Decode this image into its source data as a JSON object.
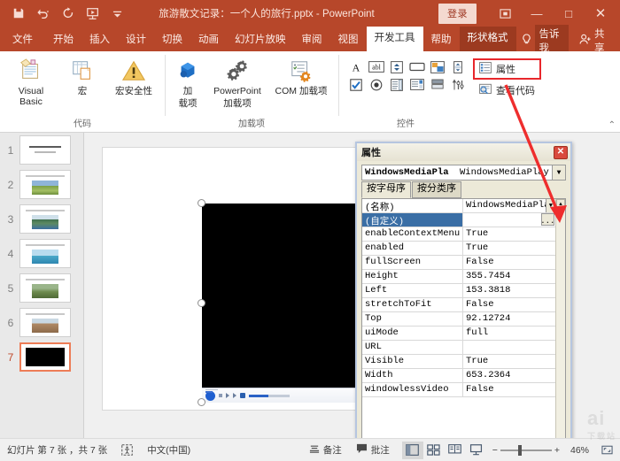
{
  "titlebar": {
    "quick_access": [
      {
        "name": "save-icon",
        "label": "保存"
      },
      {
        "name": "undo-icon",
        "label": "撤销"
      },
      {
        "name": "redo-icon",
        "label": "恢复"
      },
      {
        "name": "start-slideshow-icon",
        "label": "从头开始"
      },
      {
        "name": "customize-qat-icon",
        "label": "自定义快速访问工具栏"
      }
    ],
    "document_title": "旅游散文记录：一个人的旅行.pptx",
    "app_name": "PowerPoint",
    "title_separator": "-",
    "signin_label": "登录",
    "ribbon_display_icon": "ribbon-display-options-icon",
    "minimize_label": "—",
    "maximize_label": "□",
    "close_label": "✕"
  },
  "tabs": [
    {
      "label": "文件",
      "state": "file"
    },
    {
      "label": "开始",
      "state": "normal"
    },
    {
      "label": "插入",
      "state": "normal"
    },
    {
      "label": "设计",
      "state": "normal"
    },
    {
      "label": "切换",
      "state": "normal"
    },
    {
      "label": "动画",
      "state": "normal"
    },
    {
      "label": "幻灯片放映",
      "state": "normal"
    },
    {
      "label": "审阅",
      "state": "normal"
    },
    {
      "label": "视图",
      "state": "normal"
    },
    {
      "label": "开发工具",
      "state": "active"
    },
    {
      "label": "帮助",
      "state": "normal"
    },
    {
      "label": "形状格式",
      "state": "contextual"
    }
  ],
  "tellme": {
    "icon": "lightbulb-icon",
    "label": "告诉我"
  },
  "share": {
    "icon": "share-person-icon",
    "label": "共享"
  },
  "ribbon": {
    "groups": [
      {
        "label": "代码",
        "buttons": [
          {
            "name": "visual-basic-button",
            "label": "Visual Basic",
            "icon": "visual-basic-icon"
          },
          {
            "name": "macro-button",
            "label": "宏",
            "icon": "macro-icon"
          },
          {
            "name": "macro-security-button",
            "label": "宏安全性",
            "icon": "warning-triangle-icon"
          }
        ]
      },
      {
        "label": "加载项",
        "buttons": [
          {
            "name": "addins-button",
            "label": "加\n载项",
            "label_line1": "加",
            "label_line2": "载项",
            "icon": "addins-cube-icon"
          },
          {
            "name": "powerpoint-addins-button",
            "label_line1": "PowerPoint",
            "label_line2": "加载项",
            "icon": "gears-icon"
          },
          {
            "name": "com-addins-button",
            "label_line1": "COM 加载项",
            "label_line2": "",
            "icon": "com-addins-icon"
          }
        ]
      },
      {
        "label": "控件",
        "control_icons_row1": [
          "label-A-icon",
          "textbox-abl-icon",
          "spin-button-icon",
          "command-button-icon",
          "image-control-icon",
          "scrollbar-icon"
        ],
        "control_icons_row2": [
          "checkbox-icon",
          "option-button-icon",
          "listbox-icon",
          "combobox-icon",
          "toggle-button-icon",
          "more-controls-icon"
        ],
        "properties_button": {
          "name": "properties-button",
          "label": "属性",
          "icon": "properties-icon",
          "highlighted": true
        },
        "view_code_button": {
          "name": "view-code-button",
          "label": "查看代码",
          "icon": "view-code-icon"
        }
      }
    ],
    "collapse_ribbon_icon": "chevron-up-icon"
  },
  "thumbnails": [
    {
      "number": "1",
      "selected": false,
      "type": "title"
    },
    {
      "number": "2",
      "selected": false,
      "type": "photo"
    },
    {
      "number": "3",
      "selected": false,
      "type": "photo"
    },
    {
      "number": "4",
      "selected": false,
      "type": "photo"
    },
    {
      "number": "5",
      "selected": false,
      "type": "photo"
    },
    {
      "number": "6",
      "selected": false,
      "type": "photo"
    },
    {
      "number": "7",
      "selected": true,
      "type": "video"
    }
  ],
  "slide": {
    "media_object_name": "windows-media-player-object",
    "selection_handles": 4
  },
  "properties_window": {
    "title": "属性",
    "close_label": "✕",
    "combo_left": "WindowsMediaPla",
    "combo_right": "WindowsMediaPlay",
    "tab_alphabetic": "按字母序",
    "tab_categorized": "按分类序",
    "rows": [
      {
        "key": "(名称)",
        "value": "WindowsMediaPlay",
        "selected": false,
        "dropdown": true
      },
      {
        "key": "(自定义)",
        "value": "",
        "selected": true,
        "builder": "..."
      },
      {
        "key": "enableContextMenu",
        "value": "True",
        "selected": false
      },
      {
        "key": "enabled",
        "value": "True",
        "selected": false
      },
      {
        "key": "fullScreen",
        "value": "False",
        "selected": false
      },
      {
        "key": "Height",
        "value": "355.7454",
        "selected": false
      },
      {
        "key": "Left",
        "value": "153.3818",
        "selected": false
      },
      {
        "key": "stretchToFit",
        "value": "False",
        "selected": false
      },
      {
        "key": "Top",
        "value": "92.12724",
        "selected": false
      },
      {
        "key": "uiMode",
        "value": "full",
        "selected": false
      },
      {
        "key": "URL",
        "value": "",
        "selected": false
      },
      {
        "key": "Visible",
        "value": "True",
        "selected": false
      },
      {
        "key": "Width",
        "value": "653.2364",
        "selected": false
      },
      {
        "key": "windowlessVideo",
        "value": "False",
        "selected": false
      }
    ]
  },
  "statusbar": {
    "slide_info": "幻灯片 第 7 张 ，共 7 张",
    "accessibility_icon": "accessibility-check-icon",
    "language": "中文(中国)",
    "notes": {
      "icon": "notes-icon",
      "label": "备注"
    },
    "comments": {
      "icon": "comment-icon",
      "label": "批注"
    },
    "views": [
      {
        "name": "normal-view-button",
        "icon": "normal-view-icon",
        "active": true
      },
      {
        "name": "slide-sorter-button",
        "icon": "slide-sorter-icon",
        "active": false
      },
      {
        "name": "reading-view-button",
        "icon": "reading-view-icon",
        "active": false
      },
      {
        "name": "slideshow-button",
        "icon": "slideshow-icon",
        "active": false
      }
    ],
    "zoom_out": "−",
    "zoom_in": "+",
    "zoom_value": "46%",
    "fit_slide_icon": "fit-to-window-icon"
  },
  "colors": {
    "brand": "#b7472a",
    "contextual_tab": "#9c3a20",
    "highlight_red": "#e8272c",
    "selection_blue": "#3a6ea5",
    "thumb_selected": "#ed7d57"
  }
}
